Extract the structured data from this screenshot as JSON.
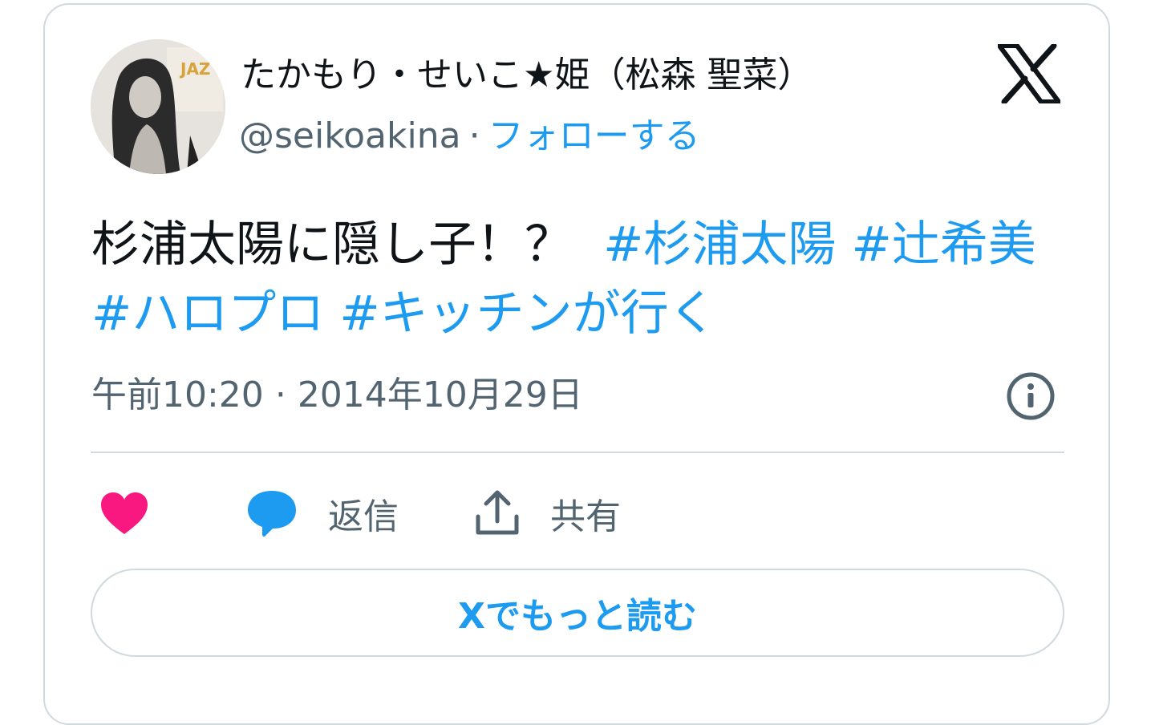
{
  "author": {
    "display_name": "たかもり・せいこ★姫（松森 聖菜）",
    "handle": "@seikoakina",
    "separator": "·",
    "follow_label": "フォローする"
  },
  "tweet": {
    "text_plain": "杉浦太陽に隠し子！？",
    "hashtags": [
      "#杉浦太陽",
      "#辻希美",
      "#ハロプロ",
      "#キッチンが行く"
    ]
  },
  "meta": {
    "time": "午前10:20",
    "separator": "·",
    "date": "2014年10月29日"
  },
  "actions": {
    "like_icon": "heart-icon",
    "reply_icon": "speech-bubble-icon",
    "reply_label": "返信",
    "share_icon": "upload-icon",
    "share_label": "共有"
  },
  "read_more_label": "Xでもっと読む",
  "colors": {
    "accent": "#1d9bf0",
    "like": "#f91880",
    "text": "#0f1419",
    "secondary": "#536471",
    "border": "#cfd9de"
  },
  "icons": {
    "brand": "x-logo-icon",
    "info": "info-icon"
  }
}
